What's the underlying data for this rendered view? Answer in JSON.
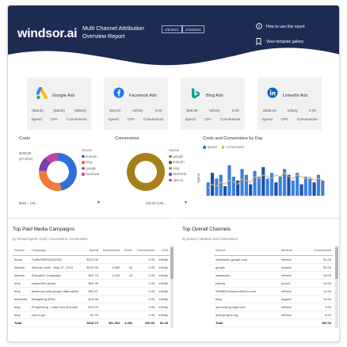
{
  "header": {
    "logo": "windsor.ai",
    "title_line1": "Multi Channel Attribution",
    "title_line2": "Overview Report",
    "date_from": "2/6/2021",
    "date_to": "2/19/2021",
    "link_howto": "How to use this report",
    "link_gallery": "View template gallery"
  },
  "kpis": [
    {
      "name": "Google Ads",
      "spend": "(Blank)",
      "cpa": "(Blank)",
      "conv": "(Blank)",
      "icon": "google-ads-icon",
      "color": "#fbbc04"
    },
    {
      "name": "Facebook Ads",
      "spend": "$34.87",
      "cpa": "Infinity",
      "conv": "0.00",
      "icon": "facebook-icon",
      "color": "#1877f2"
    },
    {
      "name": "Bing Ads",
      "spend": "$98.99",
      "cpa": "Infinity",
      "conv": "0.00",
      "icon": "bing-icon",
      "color": "#00a693"
    },
    {
      "name": "LinkedIn Ads",
      "spend": "$298.63",
      "cpa": "Infinity",
      "conv": "0.00",
      "icon": "linkedin-icon",
      "color": "#0a66c2"
    }
  ],
  "kpi_labels": {
    "spend": "Spend",
    "cpa": "CPA",
    "conv": "Conversions"
  },
  "costs": {
    "title": "Costs",
    "legend_title": "Source",
    "label_top": "$169.00",
    "label_top2": "(27.31%)",
    "label_bottom": "$183... (29...",
    "legend": [
      {
        "name": "linkedin",
        "color": "#1f5ec4"
      },
      {
        "name": "bing",
        "color": "#e8672b"
      },
      {
        "name": "google",
        "color": "#7a3fb0"
      },
      {
        "name": "facebook",
        "color": "#c83f9a"
      }
    ],
    "slices": [
      0.47,
      0.29,
      0.13,
      0.11
    ],
    "slice_colors": [
      "#2f6fd6",
      "#f07a37",
      "#7a3fb0",
      "#c83f9a"
    ]
  },
  "conversions": {
    "title": "Conversions",
    "legend_title": "Source",
    "label_right": "250.00 (100...",
    "legend": [
      {
        "name": "google",
        "color": "#a77e1a"
      },
      {
        "name": "linkedin",
        "color": "#555555"
      },
      {
        "name": "bing",
        "color": "#888888"
      },
      {
        "name": "facebook",
        "color": "#7a3fb0"
      },
      {
        "name": "(direct)",
        "color": "#c83f9a"
      }
    ],
    "slices": [
      1.0
    ],
    "slice_colors": [
      "#a77e1a"
    ]
  },
  "costs_by_day": {
    "title": "Costs and Conversions by Day",
    "legend": [
      {
        "name": "Spend",
        "color": "#2f6fd6"
      },
      {
        "name": "Conversions",
        "color": "#e8b44b"
      }
    ],
    "ylabel": "Spend",
    "bars": [
      0.35,
      0.6,
      0.45,
      0.55,
      0.25,
      0.8,
      0.5,
      0.4,
      0.7,
      0.55,
      0.3,
      0.65,
      0.5,
      0.75,
      0.45,
      0.6,
      0.35,
      0.5,
      0.7,
      0.55,
      0.4,
      0.6,
      0.3,
      0.5,
      0.45,
      0.35,
      0.55,
      0.4
    ],
    "line": [
      0.2,
      0.3,
      0.25,
      0.35,
      0.3,
      0.4,
      0.35,
      0.3,
      0.45,
      0.4,
      0.35,
      0.5,
      0.45,
      0.55,
      0.5,
      0.45,
      0.55,
      0.5,
      0.6,
      0.5,
      0.45,
      0.55,
      0.5,
      0.45,
      0.5,
      0.4,
      0.45,
      0.4
    ]
  },
  "campaigns": {
    "title": "Top Paid Media Campaigns",
    "subtitle": "by Amount spent, Cost | Conversions, Conversions",
    "columns": [
      "Source",
      "Campaign",
      "Spend",
      "Impressions",
      "Clicks",
      "Conversions",
      "CPA"
    ],
    "rows": [
      [
        "fbook",
        "Traffic20094/3/18/332",
        "$123.06",
        "",
        "",
        "0.00",
        "Infinity"
      ],
      [
        "linkedin",
        "Website visits - May 17, 2019",
        "$137.95",
        "3,089",
        "54",
        "0.00",
        "Infinity"
      ],
      [
        "linkedin",
        "Education Campaign",
        "$90.78",
        "2,119",
        "15",
        "0.00",
        "Infinity"
      ],
      [
        "bing",
        "competitor global",
        "$64.35",
        "",
        "",
        "0.00",
        "Infinity"
      ],
      [
        "bing",
        "facebook-data-google-data-studio",
        "$52.57",
        "",
        "",
        "0.00",
        "Infinity"
      ],
      [
        "facebook",
        "retargeting APAC",
        "$14.98",
        "",
        "",
        "0.00",
        "Infinity"
      ],
      [
        "bing",
        "Prospecting - Lead Gen (Europe)",
        "$12.00",
        "",
        "",
        "0.00",
        "Infinity"
      ],
      [
        "bing",
        "cms-to-go",
        "$7.00",
        "",
        "",
        "0.00",
        "Infinity"
      ]
    ],
    "total": [
      "Total",
      "",
      "$618.79",
      "381,954",
      "3,483",
      "250.00",
      "$2.48"
    ]
  },
  "channels": {
    "title": "Top Overall Channels",
    "subtitle": "by Source | Medium and Conversions",
    "columns": [
      "Source",
      "Medium",
      "Conversions"
    ],
    "rows": [
      [
        "datastudio.google.com",
        "referral",
        " 51.00"
      ],
      [
        "google",
        "organic",
        " 30.00"
      ],
      [
        "datastudio",
        "referral",
        " 16.00"
      ],
      [
        "(direct)",
        "(none)",
        " 14.00"
      ],
      [
        "5466893.keywordtool.io.com",
        "referral",
        " 11.00"
      ],
      [
        "bing",
        "organic",
        " 10.00"
      ],
      [
        "accounts.google.com",
        "referral",
        " 9.00"
      ],
      [
        "amprproject.org",
        "referral",
        " 8.00"
      ]
    ],
    "total": [
      "Total",
      "",
      "250.00"
    ]
  }
}
